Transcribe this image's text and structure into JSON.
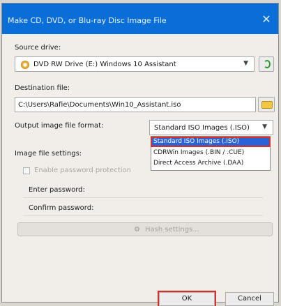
{
  "window": {
    "title": "Make CD, DVD, or Blu-ray Disc Image File",
    "close_glyph": "✕"
  },
  "source_drive": {
    "label": "Source drive:",
    "value": "DVD RW Drive (E:) Windows 10 Assistant",
    "icon": "disc-icon",
    "refresh_icon": "refresh-icon"
  },
  "destination": {
    "label": "Destination file:",
    "value": "C:\\Users\\Rafie\\Documents\\Win10_Assistant.iso",
    "browse_icon": "folder-icon"
  },
  "output_format": {
    "label": "Output image file format:",
    "selected": "Standard ISO Images (.ISO)",
    "options": [
      "Standard ISO Images (.ISO)",
      "CDRWin Images (.BIN / .CUE)",
      "Direct Access Archive (.DAA)"
    ]
  },
  "image_settings": {
    "label": "Image file settings:",
    "enable_password": "Enable password protection",
    "enter_password": "Enter password:",
    "confirm_password": "Confirm password:"
  },
  "hash_button": {
    "label": "Hash settings...",
    "icon": "hash-icon"
  },
  "buttons": {
    "ok": "OK",
    "cancel": "Cancel"
  },
  "colors": {
    "titlebar": "#0a6ed8",
    "selection": "#2a63d6",
    "highlight_box": "#d93025"
  }
}
